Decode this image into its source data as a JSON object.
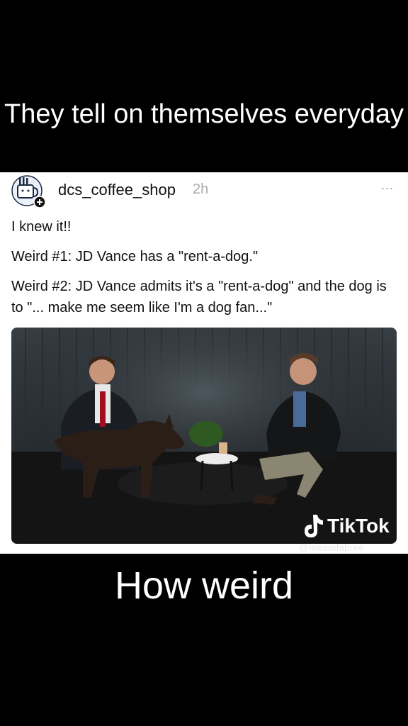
{
  "caption_top": "They tell on themselves everyday",
  "caption_bottom": "How weird",
  "post": {
    "username": "dcs_coffee_shop",
    "timestamp": "2h",
    "more_label": "...",
    "lines": [
      "I knew it!!",
      "Weird #1: JD Vance has a \"rent-a-dog.\"",
      "Weird #2: JD Vance admits it's a \"rent-a-dog\" and the dog is to \"... make me seem like I'm a dog fan...\""
    ]
  },
  "watermark": {
    "logo_text": "TikTok",
    "handle": "@mesadabree"
  },
  "colors": {
    "background": "#000000",
    "post_bg": "#ffffff",
    "text": "#111111",
    "timestamp": "#aaaaaa"
  }
}
